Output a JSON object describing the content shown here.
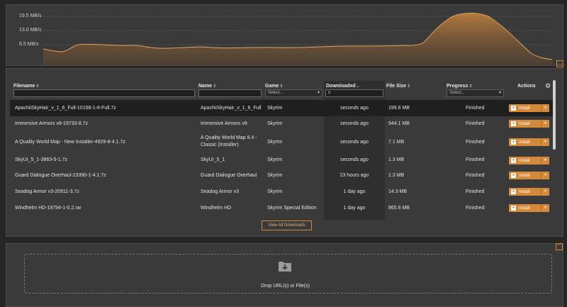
{
  "graph": {
    "y_labels": [
      "19.5 MB/s",
      "13.0 MB/s",
      "6.5 MB/s"
    ],
    "collapse_icon": "chevron-up-icon",
    "accent": "#d48a3a"
  },
  "downloads": {
    "columns": {
      "filename": "Filename",
      "name": "Name",
      "game": "Game",
      "downloaded": "Downloaded",
      "filesize": "File Size",
      "progress": "Progress",
      "actions": "Actions"
    },
    "filters": {
      "game_placeholder": "Select...",
      "downloaded_value": "≥",
      "progress_placeholder": "Select..."
    },
    "rows": [
      {
        "filename": "ApachiiSkyHair_v_1_6_Full-10168-1-6-Full.7z",
        "name": "ApachiiSkyHair_v_1_6_Full",
        "game": "Skyrim",
        "downloaded": "seconds ago",
        "size": "199.6 MB",
        "progress": "Finished",
        "action": "Install"
      },
      {
        "filename": "Immersive Armors v8-19733-8.7z",
        "name": "Immersive Armors v8",
        "game": "Skyrim",
        "downloaded": "seconds ago",
        "size": "944.1 MB",
        "progress": "Finished",
        "action": "Install"
      },
      {
        "filename": "A Quality World Map - New Installer-4929-8-4.1.7z",
        "name": "A Quality World Map 8.4 - Classic (Installer)",
        "game": "Skyrim",
        "downloaded": "seconds ago",
        "size": "7.1 MB",
        "progress": "Finished",
        "action": "Install"
      },
      {
        "filename": "SkyUI_5_1-3863-5-1.7z",
        "name": "SkyUI_5_1",
        "game": "Skyrim",
        "downloaded": "seconds ago",
        "size": "1.3 MB",
        "progress": "Finished",
        "action": "Install"
      },
      {
        "filename": "Guard Dialogue Overhaul-23390-1-4.1.7z",
        "name": "Guard Dialogue Overhaul",
        "game": "Skyrim",
        "downloaded": "23 hours ago",
        "size": "1.3 MB",
        "progress": "Finished",
        "action": "Install"
      },
      {
        "filename": "Seadog Armor v3-20911-3.7z",
        "name": "Seadog Armor v3",
        "game": "Skyrim",
        "downloaded": "1 day ago",
        "size": "14.3 MB",
        "progress": "Finished",
        "action": "Install"
      },
      {
        "filename": "Windhelm HD-19794-1-0.2.rar",
        "name": "Windhelm HD",
        "game": "Skyrim Special Edition",
        "downloaded": "1 day ago",
        "size": "865.6 MB",
        "progress": "Finished",
        "action": "Install"
      }
    ],
    "view_all_label": "View All Downloads"
  },
  "dropzone": {
    "text": "Drop URL(s) or File(s)",
    "icon": "download-icon",
    "collapse_icon": "chevron-down-icon"
  }
}
